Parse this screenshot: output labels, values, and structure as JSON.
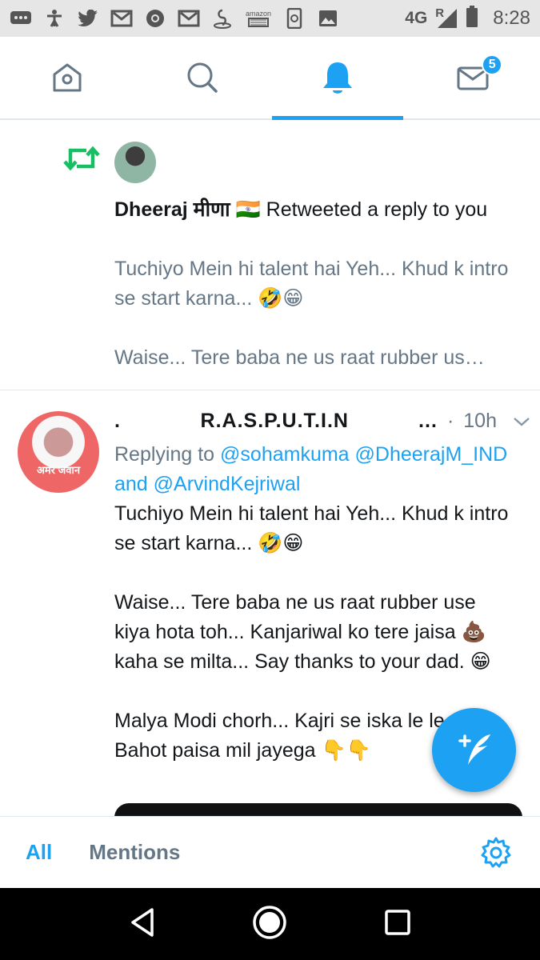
{
  "status_bar": {
    "network": "4G",
    "signal_label": "R",
    "time": "8:28",
    "icons": [
      "messages-icon",
      "accessibility-icon",
      "twitter-icon",
      "gmail-icon",
      "chrome-icon",
      "gmail-icon",
      "app-icon",
      "amazon-icon",
      "phone-update-icon",
      "image-icon"
    ],
    "amazon_label": "amazon"
  },
  "top_nav": {
    "tabs": [
      "home-icon",
      "search-icon",
      "notifications-icon",
      "messages-icon"
    ],
    "active_tab": "notifications",
    "messages_badge": "5",
    "accent": "#1da1f2"
  },
  "notification": {
    "user_name": "Dheeraj मीणा 🇮🇳",
    "action": " Retweeted a reply to you",
    "preview_line1": "Tuchiyo Mein hi talent hai Yeh... Khud k intro se start karna... 🤣😁",
    "preview_line2": "Waise... Tere baba ne us raat rubber us…"
  },
  "tweet": {
    "name_prefix": ".",
    "name": "R.A.S.P.U.T.I.N",
    "name_suffix": "…",
    "separator": "·",
    "time": "10h",
    "avatar_label": "अमर जवान",
    "replying_to_label": "Replying to ",
    "replying_to": "@sohamkuma @DheerajM_IND and @ArvindKejriwal",
    "paragraphs": [
      "Tuchiyo Mein hi talent hai Yeh... Khud k intro se start karna... 🤣😁",
      "Waise... Tere baba ne us raat rubber use kiya hota toh... Kanjariwal ko tere jaisa 💩 kaha se milta... Say thanks to your dad. 😁",
      "Malya Modi chorh... Kajri se iska le le... Bahot paisa mil jayega 👇👇"
    ]
  },
  "filter_bar": {
    "all": "All",
    "mentions": "Mentions"
  },
  "colors": {
    "accent": "#1da1f2",
    "retweet_green": "#17bf63",
    "secondary_text": "#657786"
  }
}
